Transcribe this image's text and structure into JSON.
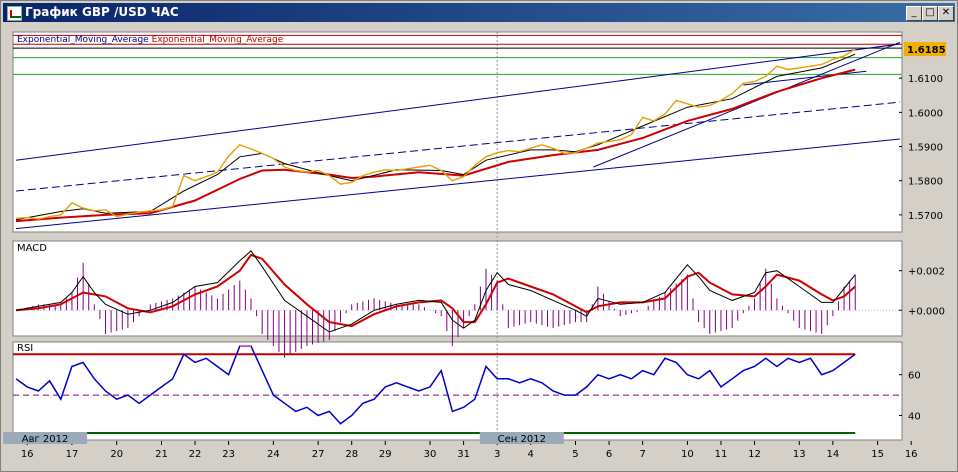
{
  "window": {
    "title": "График GBP /USD  ЧАС",
    "minimize": "_",
    "maximize": "□",
    "close": "✕"
  },
  "colors": {
    "price": "#e8a000",
    "ema_slow": "#d00000",
    "ema_fast": "#000000",
    "channel": "#00008b",
    "hline_red": "#c00000",
    "hline_green": "#22aa22",
    "macd_hist": "#800080",
    "rsi": "#0000cc",
    "rsi_over": "#e040e0",
    "rsi_mid": "#800080",
    "time_bar": "#006400"
  },
  "chart_data": [
    {
      "type": "line",
      "panel": "price",
      "legend": [
        "Exponential_Moving_Average",
        "Exponential_Moving_Average"
      ],
      "last_price": "1.6185",
      "y_ticks": [
        "1.5700",
        "1.5800",
        "1.5900",
        "1.6000",
        "1.6100"
      ],
      "ylim": [
        1.565,
        1.6235
      ],
      "x_range": [
        0,
        39.5
      ],
      "series": {
        "price": [
          [
            0,
            1.569
          ],
          [
            0.5,
            1.5692
          ],
          [
            1,
            1.5688
          ],
          [
            1.5,
            1.5695
          ],
          [
            2,
            1.57
          ],
          [
            2.5,
            1.5735
          ],
          [
            3,
            1.572
          ],
          [
            3.5,
            1.5712
          ],
          [
            4,
            1.5715
          ],
          [
            4.5,
            1.5695
          ],
          [
            5,
            1.5702
          ],
          [
            5.5,
            1.5708
          ],
          [
            6,
            1.5712
          ],
          [
            6.5,
            1.5715
          ],
          [
            7,
            1.5725
          ],
          [
            7.5,
            1.5815
          ],
          [
            8,
            1.58
          ],
          [
            8.5,
            1.5812
          ],
          [
            9,
            1.5825
          ],
          [
            9.5,
            1.5872
          ],
          [
            10,
            1.5905
          ],
          [
            10.5,
            1.5893
          ],
          [
            11,
            1.588
          ],
          [
            11.5,
            1.5865
          ],
          [
            12,
            1.584
          ],
          [
            12.5,
            1.583
          ],
          [
            13,
            1.5825
          ],
          [
            13.5,
            1.583
          ],
          [
            14,
            1.5815
          ],
          [
            14.5,
            1.579
          ],
          [
            15,
            1.5795
          ],
          [
            15.5,
            1.5815
          ],
          [
            16,
            1.5825
          ],
          [
            16.5,
            1.5832
          ],
          [
            17,
            1.583
          ],
          [
            17.5,
            1.5835
          ],
          [
            18,
            1.584
          ],
          [
            18.5,
            1.5845
          ],
          [
            19,
            1.583
          ],
          [
            19.5,
            1.58
          ],
          [
            20,
            1.5812
          ],
          [
            20.5,
            1.5845
          ],
          [
            21,
            1.587
          ],
          [
            21.5,
            1.5882
          ],
          [
            22,
            1.5888
          ],
          [
            22.5,
            1.5885
          ],
          [
            23,
            1.5895
          ],
          [
            23.5,
            1.5905
          ],
          [
            24,
            1.5895
          ],
          [
            24.5,
            1.588
          ],
          [
            25,
            1.5882
          ],
          [
            25.5,
            1.5895
          ],
          [
            26,
            1.591
          ],
          [
            26.5,
            1.5915
          ],
          [
            27,
            1.592
          ],
          [
            27.5,
            1.5935
          ],
          [
            28,
            1.5985
          ],
          [
            28.5,
            1.5975
          ],
          [
            29,
            1.5995
          ],
          [
            29.5,
            1.6035
          ],
          [
            30,
            1.6025
          ],
          [
            30.5,
            1.6015
          ],
          [
            31,
            1.602
          ],
          [
            31.5,
            1.6035
          ],
          [
            32,
            1.6055
          ],
          [
            32.5,
            1.6085
          ],
          [
            33,
            1.609
          ],
          [
            33.5,
            1.6105
          ],
          [
            34,
            1.6135
          ],
          [
            34.5,
            1.6125
          ],
          [
            35,
            1.613
          ],
          [
            35.5,
            1.6135
          ],
          [
            36,
            1.614
          ],
          [
            36.5,
            1.6155
          ],
          [
            37,
            1.6165
          ],
          [
            37.5,
            1.6185
          ]
        ],
        "ema_slow": [
          [
            0,
            1.5682
          ],
          [
            2,
            1.5692
          ],
          [
            4,
            1.57
          ],
          [
            6,
            1.5705
          ],
          [
            8,
            1.5742
          ],
          [
            10,
            1.5805
          ],
          [
            11,
            1.583
          ],
          [
            12,
            1.5832
          ],
          [
            14,
            1.5818
          ],
          [
            15,
            1.5808
          ],
          [
            16,
            1.5812
          ],
          [
            18,
            1.5825
          ],
          [
            20,
            1.5815
          ],
          [
            22,
            1.5855
          ],
          [
            24,
            1.5875
          ],
          [
            26,
            1.589
          ],
          [
            28,
            1.5925
          ],
          [
            30,
            1.5975
          ],
          [
            32,
            1.601
          ],
          [
            34,
            1.606
          ],
          [
            36,
            1.61
          ],
          [
            37.5,
            1.6125
          ]
        ],
        "ema_fast": [
          [
            0,
            1.5686
          ],
          [
            2,
            1.571
          ],
          [
            3,
            1.5718
          ],
          [
            4,
            1.5705
          ],
          [
            6,
            1.571
          ],
          [
            7.5,
            1.577
          ],
          [
            9,
            1.5818
          ],
          [
            10,
            1.587
          ],
          [
            11,
            1.588
          ],
          [
            12,
            1.585
          ],
          [
            14,
            1.5815
          ],
          [
            15,
            1.58
          ],
          [
            17,
            1.5832
          ],
          [
            19,
            1.583
          ],
          [
            20,
            1.5818
          ],
          [
            21,
            1.586
          ],
          [
            23,
            1.589
          ],
          [
            24,
            1.589
          ],
          [
            25,
            1.5885
          ],
          [
            26,
            1.5905
          ],
          [
            28,
            1.596
          ],
          [
            30,
            1.6015
          ],
          [
            32,
            1.604
          ],
          [
            34,
            1.6105
          ],
          [
            36,
            1.613
          ],
          [
            37.5,
            1.617
          ]
        ],
        "channel_upper": [
          [
            0,
            1.586
          ],
          [
            39.5,
            1.62
          ]
        ],
        "channel_mid": [
          [
            0,
            1.577
          ],
          [
            39.5,
            1.603
          ]
        ],
        "channel_lower": [
          [
            0,
            1.566
          ],
          [
            39.5,
            1.5922
          ]
        ],
        "trend_short": [
          [
            25.8,
            1.584
          ],
          [
            39.5,
            1.6205
          ]
        ],
        "trend_steep": [
          [
            32.5,
            1.608
          ],
          [
            38,
            1.612
          ]
        ]
      },
      "hlines_red": [
        1.6225,
        1.6199
      ],
      "hline_black": 1.6188,
      "hlines_green": [
        1.616,
        1.6111
      ],
      "vline_x": 21.5
    },
    {
      "type": "line",
      "panel": "macd",
      "title": "MACD",
      "y_ticks": [
        "+0.002",
        "+0.000"
      ],
      "ylim": [
        -0.0013,
        0.0035
      ],
      "macd": [
        [
          0,
          0.0
        ],
        [
          1,
          0.0002
        ],
        [
          2,
          0.0004
        ],
        [
          2.5,
          0.0009
        ],
        [
          3,
          0.0017
        ],
        [
          3.5,
          0.0009
        ],
        [
          4,
          0.0003
        ],
        [
          5,
          -0.0002
        ],
        [
          6,
          0.0
        ],
        [
          7,
          0.0004
        ],
        [
          8,
          0.0012
        ],
        [
          9,
          0.0014
        ],
        [
          10,
          0.0025
        ],
        [
          10.5,
          0.003
        ],
        [
          11,
          0.0022
        ],
        [
          12,
          0.0005
        ],
        [
          13,
          -0.0003
        ],
        [
          14,
          -0.0011
        ],
        [
          15,
          -0.0007
        ],
        [
          16,
          0.0
        ],
        [
          17,
          0.0003
        ],
        [
          18,
          0.0005
        ],
        [
          19,
          0.0004
        ],
        [
          19.5,
          -0.0005
        ],
        [
          20,
          -0.0009
        ],
        [
          20.5,
          -0.0005
        ],
        [
          21,
          0.001
        ],
        [
          21.5,
          0.0019
        ],
        [
          22,
          0.0013
        ],
        [
          23,
          0.001
        ],
        [
          24,
          0.0005
        ],
        [
          25,
          0.0
        ],
        [
          25.5,
          -0.0003
        ],
        [
          26,
          0.0006
        ],
        [
          27,
          0.0003
        ],
        [
          28,
          0.0004
        ],
        [
          29,
          0.0009
        ],
        [
          30,
          0.0023
        ],
        [
          30.5,
          0.0017
        ],
        [
          31,
          0.001
        ],
        [
          32,
          0.0005
        ],
        [
          33,
          0.0009
        ],
        [
          33.5,
          0.0019
        ],
        [
          34,
          0.002
        ],
        [
          35,
          0.0012
        ],
        [
          36,
          0.0004
        ],
        [
          36.5,
          0.0004
        ],
        [
          37,
          0.0011
        ],
        [
          37.5,
          0.0018
        ]
      ],
      "signal": [
        [
          0,
          0.0
        ],
        [
          1,
          0.0001
        ],
        [
          2,
          0.0003
        ],
        [
          3,
          0.0009
        ],
        [
          4,
          0.0007
        ],
        [
          5,
          0.0001
        ],
        [
          6,
          -0.0001
        ],
        [
          7,
          0.0002
        ],
        [
          8,
          0.0008
        ],
        [
          9,
          0.0012
        ],
        [
          10,
          0.002
        ],
        [
          10.5,
          0.0028
        ],
        [
          11,
          0.0026
        ],
        [
          12,
          0.0013
        ],
        [
          13,
          0.0003
        ],
        [
          14,
          -0.0006
        ],
        [
          15,
          -0.0008
        ],
        [
          16,
          -0.0002
        ],
        [
          17,
          0.0002
        ],
        [
          18,
          0.0004
        ],
        [
          19,
          0.0005
        ],
        [
          19.5,
          0.0001
        ],
        [
          20,
          -0.0006
        ],
        [
          20.5,
          -0.0006
        ],
        [
          21,
          0.0003
        ],
        [
          21.5,
          0.0014
        ],
        [
          22,
          0.0016
        ],
        [
          23,
          0.0012
        ],
        [
          24,
          0.0008
        ],
        [
          25,
          0.0002
        ],
        [
          25.5,
          -0.0001
        ],
        [
          26,
          0.0002
        ],
        [
          27,
          0.0004
        ],
        [
          28,
          0.0004
        ],
        [
          29,
          0.0006
        ],
        [
          30,
          0.0017
        ],
        [
          30.5,
          0.0019
        ],
        [
          31,
          0.0014
        ],
        [
          32,
          0.0008
        ],
        [
          33,
          0.0007
        ],
        [
          33.5,
          0.0012
        ],
        [
          34,
          0.0018
        ],
        [
          35,
          0.0015
        ],
        [
          36,
          0.0008
        ],
        [
          36.5,
          0.0005
        ],
        [
          37,
          0.0007
        ],
        [
          37.5,
          0.0012
        ]
      ]
    },
    {
      "type": "line",
      "panel": "rsi",
      "title": "RSI",
      "y_ticks": [
        "60",
        "40"
      ],
      "ylim": [
        28,
        76
      ],
      "overbought": 70,
      "midline": 50,
      "rsi": [
        [
          0,
          58
        ],
        [
          0.5,
          54
        ],
        [
          1,
          52
        ],
        [
          1.5,
          57
        ],
        [
          2,
          48
        ],
        [
          2.5,
          64
        ],
        [
          3,
          66
        ],
        [
          3.5,
          58
        ],
        [
          4,
          52
        ],
        [
          4.5,
          48
        ],
        [
          5,
          50
        ],
        [
          5.5,
          46
        ],
        [
          6,
          50
        ],
        [
          6.5,
          54
        ],
        [
          7,
          58
        ],
        [
          7.5,
          70
        ],
        [
          8,
          66
        ],
        [
          8.5,
          68
        ],
        [
          9,
          64
        ],
        [
          9.5,
          60
        ],
        [
          10,
          74
        ],
        [
          10.5,
          74
        ],
        [
          11,
          62
        ],
        [
          11.5,
          50
        ],
        [
          12,
          46
        ],
        [
          12.5,
          42
        ],
        [
          13,
          44
        ],
        [
          13.5,
          40
        ],
        [
          14,
          42
        ],
        [
          14.5,
          36
        ],
        [
          15,
          40
        ],
        [
          15.5,
          46
        ],
        [
          16,
          48
        ],
        [
          16.5,
          54
        ],
        [
          17,
          56
        ],
        [
          17.5,
          54
        ],
        [
          18,
          52
        ],
        [
          18.5,
          54
        ],
        [
          19,
          62
        ],
        [
          19.5,
          42
        ],
        [
          20,
          44
        ],
        [
          20.5,
          48
        ],
        [
          21,
          64
        ],
        [
          21.5,
          58
        ],
        [
          22,
          58
        ],
        [
          22.5,
          56
        ],
        [
          23,
          58
        ],
        [
          23.5,
          56
        ],
        [
          24,
          52
        ],
        [
          24.5,
          50
        ],
        [
          25,
          50
        ],
        [
          25.5,
          54
        ],
        [
          26,
          60
        ],
        [
          26.5,
          58
        ],
        [
          27,
          60
        ],
        [
          27.5,
          58
        ],
        [
          28,
          62
        ],
        [
          28.5,
          60
        ],
        [
          29,
          68
        ],
        [
          29.5,
          66
        ],
        [
          30,
          60
        ],
        [
          30.5,
          58
        ],
        [
          31,
          62
        ],
        [
          31.5,
          54
        ],
        [
          32,
          58
        ],
        [
          32.5,
          62
        ],
        [
          33,
          64
        ],
        [
          33.5,
          68
        ],
        [
          34,
          64
        ],
        [
          34.5,
          68
        ],
        [
          35,
          66
        ],
        [
          35.5,
          68
        ],
        [
          36,
          60
        ],
        [
          36.5,
          62
        ],
        [
          37,
          66
        ],
        [
          37.5,
          70
        ]
      ]
    }
  ],
  "x_axis": {
    "labels": [
      [
        "16",
        0.5
      ],
      [
        "17",
        2.5
      ],
      [
        "20",
        4.5
      ],
      [
        "21",
        6.5
      ],
      [
        "22",
        8.0
      ],
      [
        "23",
        9.5
      ],
      [
        "24",
        11.5
      ],
      [
        "27",
        13.5
      ],
      [
        "28",
        15.0
      ],
      [
        "29",
        16.5
      ],
      [
        "30",
        18.5
      ],
      [
        "31",
        20.0
      ],
      [
        "3",
        21.5
      ],
      [
        "4",
        23.0
      ],
      [
        "5",
        25.0
      ],
      [
        "6",
        26.5
      ],
      [
        "7",
        28.0
      ],
      [
        "10",
        30.0
      ],
      [
        "11",
        31.5
      ],
      [
        "12",
        33.0
      ],
      [
        "13",
        35.0
      ],
      [
        "14",
        36.5
      ],
      [
        "15",
        38.5
      ],
      [
        "16",
        40.0
      ]
    ],
    "month_labels": [
      [
        "Авг 2012",
        1.3
      ],
      [
        "Сен 2012",
        22.6
      ]
    ]
  }
}
